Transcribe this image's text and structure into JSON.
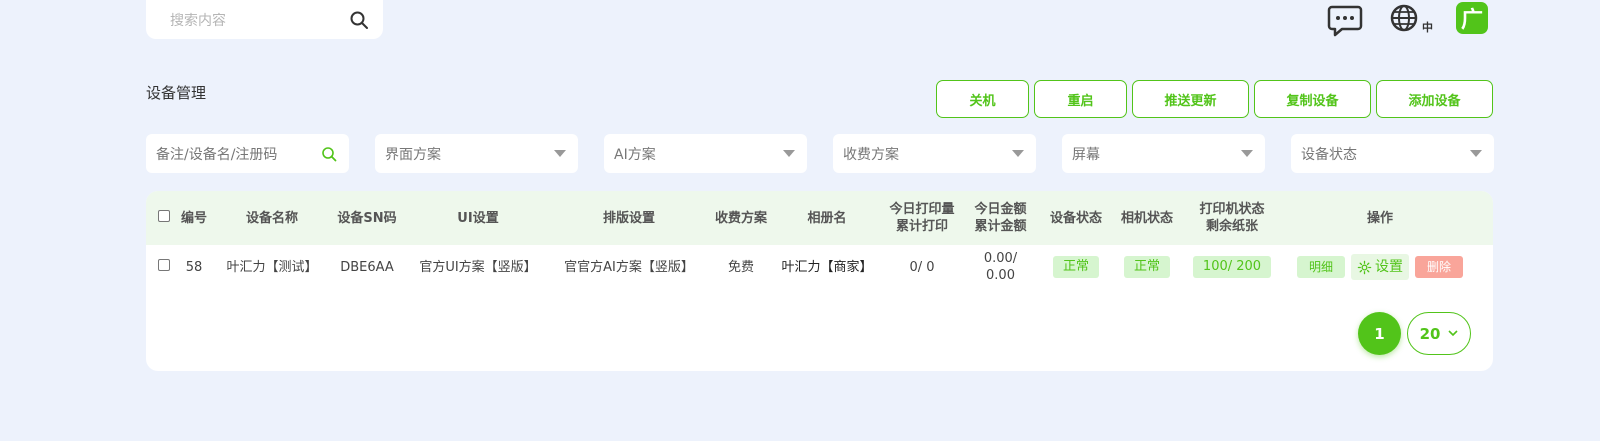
{
  "search": {
    "placeholder": "搜索内容"
  },
  "header": {
    "lang_label": "中",
    "brand_char": "广"
  },
  "page_title": "设备管理",
  "toolbar": [
    "关机",
    "重启",
    "推送更新",
    "复制设备",
    "添加设备"
  ],
  "filters": [
    {
      "text": "备注/设备名/注册码",
      "kind": "search"
    },
    {
      "text": "界面方案",
      "kind": "select"
    },
    {
      "text": "AI方案",
      "kind": "select"
    },
    {
      "text": "收费方案",
      "kind": "select"
    },
    {
      "text": "屏幕",
      "kind": "select"
    },
    {
      "text": "设备状态",
      "kind": "select"
    }
  ],
  "table": {
    "headers": {
      "id": "编号",
      "name": "设备名称",
      "sn": "设备SN码",
      "ui": "UI设置",
      "layout": "排版设置",
      "fee": "收费方案",
      "album": "相册名",
      "print_today": "今日打印量",
      "print_total": "累计打印",
      "amount_today": "今日金额",
      "amount_total": "累计金额",
      "device_status": "设备状态",
      "camera_status": "相机状态",
      "printer_status": "打印机状态",
      "paper_left": "剩余纸张",
      "ops": "操作"
    },
    "rows": [
      {
        "id": "58",
        "name": "叶汇力【测试】",
        "sn": "DBE6AA",
        "ui": "官方UI方案【竖版】",
        "layout": "官官方AI方案【竖版】",
        "fee": "免费",
        "album": "叶汇力【商家】",
        "prints": "0/ 0",
        "amount": "0.00/ 0.00",
        "device_status": "正常",
        "camera_status": "正常",
        "printer": "100/ 200",
        "detail": "明细",
        "settings": "设置",
        "delete": "删除"
      }
    ]
  },
  "pagination": {
    "current": "1",
    "page_size": "20"
  },
  "colors": {
    "accent": "#52c41a",
    "background": "#edf2fc",
    "danger": "#f9a59a"
  }
}
